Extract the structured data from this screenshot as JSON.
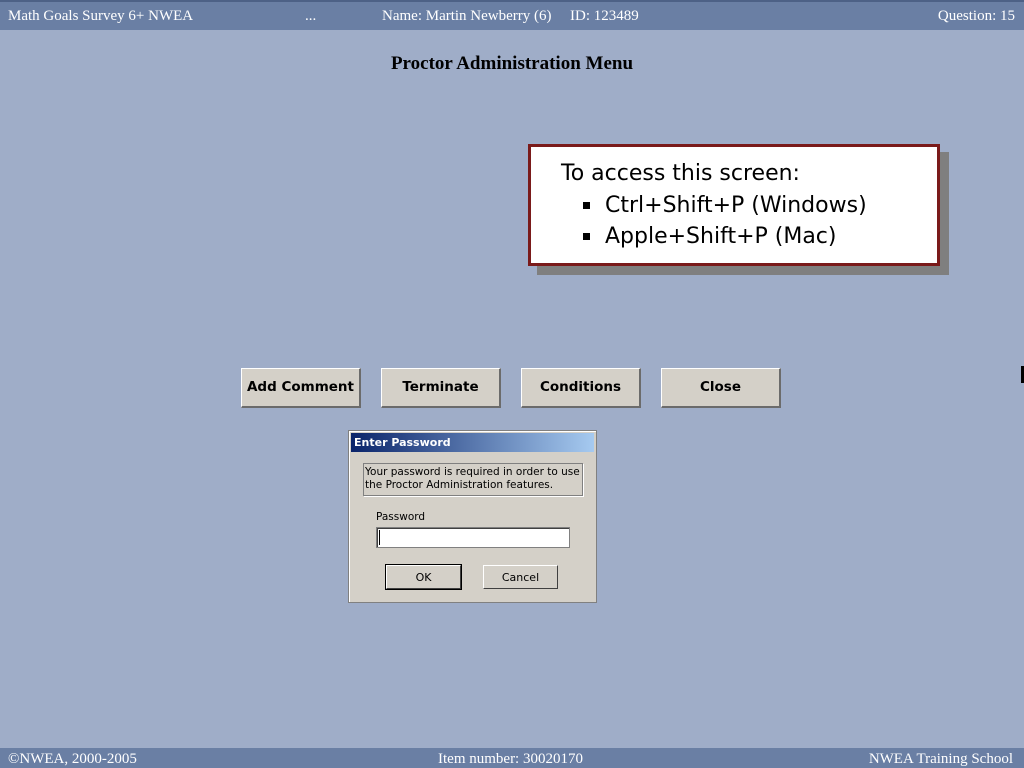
{
  "header": {
    "test_name": "Math Goals Survey 6+ NWEA",
    "ellipsis": "...",
    "student_name": "Name: Martin Newberry (6)",
    "student_id": "ID: 123489",
    "question": "Question: 15"
  },
  "main": {
    "title": "Proctor Administration Menu"
  },
  "callout": {
    "heading": "To access this screen:",
    "items": [
      "Ctrl+Shift+P (Windows)",
      "Apple+Shift+P (Mac)"
    ]
  },
  "buttons": {
    "add_comment": "Add Comment",
    "terminate": "Terminate",
    "conditions": "Conditions",
    "close": "Close"
  },
  "dialog": {
    "title": "Enter Password",
    "message": "Your password is required in order to use the Proctor Administration features.",
    "password_label": "Password",
    "password_value": "",
    "ok_label": "OK",
    "cancel_label": "Cancel"
  },
  "footer": {
    "copyright": "©NWEA, 2000-2005",
    "item_number": "Item number: 30020170",
    "school": "NWEA Training School"
  },
  "colors": {
    "background": "#9fadc8",
    "bar": "#6a7fa4",
    "callout_border": "#7a1a1a",
    "dialog_title_start": "#0a246a",
    "dialog_title_end": "#a6caf0"
  }
}
